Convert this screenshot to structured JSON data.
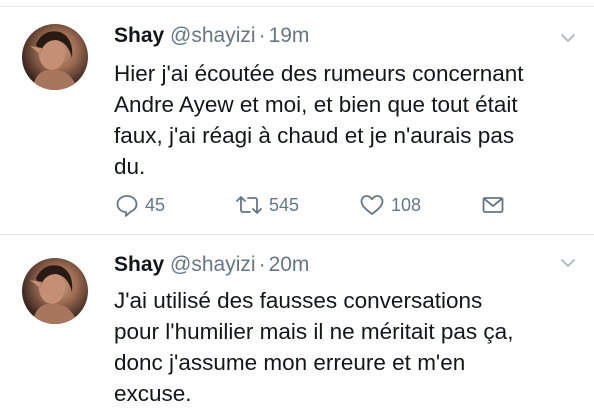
{
  "tweets": [
    {
      "name": "Shay",
      "handle": "@shayizi",
      "separator": "·",
      "time": "19m",
      "lines": [
        "Hier j'ai écoutée des rumeurs concernant",
        "Andre Ayew et moi, et bien que tout était",
        "faux, j'ai réagi à chaud et je n'aurais pas",
        "du."
      ],
      "replies": "45",
      "retweets": "545",
      "likes": "108"
    },
    {
      "name": "Shay",
      "handle": "@shayizi",
      "separator": "·",
      "time": "20m",
      "lines": [
        "J'ai utilisé des fausses conversations",
        "pour l'humilier mais il ne méritait pas ça,",
        "donc j'assume mon erreure et m'en",
        "excuse."
      ]
    }
  ],
  "icons": {
    "reply": "reply-icon",
    "retweet": "retweet-icon",
    "like": "heart-icon",
    "dm": "envelope-icon",
    "menu": "chevron-down-icon"
  },
  "colors": {
    "text": "#14171a",
    "secondary": "#657786",
    "divider": "#e1e8ed"
  }
}
